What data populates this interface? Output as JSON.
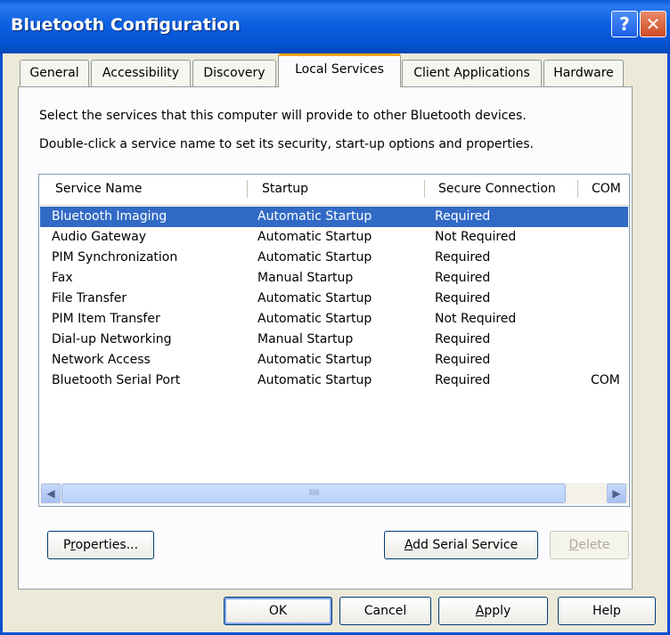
{
  "window": {
    "title": "Bluetooth Configuration",
    "help_glyph": "?",
    "close_glyph": "✕"
  },
  "tabs": [
    {
      "label": "General",
      "active": false
    },
    {
      "label": "Accessibility",
      "active": false
    },
    {
      "label": "Discovery",
      "active": false
    },
    {
      "label": "Local Services",
      "active": true
    },
    {
      "label": "Client Applications",
      "active": false
    },
    {
      "label": "Hardware",
      "active": false
    }
  ],
  "instructions": {
    "line1": "Select the services that this computer will provide to other Bluetooth devices.",
    "line2": "Double-click a service name to set its security, start-up options and properties."
  },
  "list": {
    "columns": [
      "Service Name",
      "Startup",
      "Secure Connection",
      "COM"
    ],
    "rows": [
      {
        "name": "Bluetooth Imaging",
        "startup": "Automatic Startup",
        "secure": "Required",
        "com": "",
        "selected": true
      },
      {
        "name": "Audio Gateway",
        "startup": "Automatic Startup",
        "secure": "Not Required",
        "com": ""
      },
      {
        "name": "PIM Synchronization",
        "startup": "Automatic Startup",
        "secure": "Required",
        "com": ""
      },
      {
        "name": "Fax",
        "startup": "Manual Startup",
        "secure": "Required",
        "com": ""
      },
      {
        "name": "File Transfer",
        "startup": "Automatic Startup",
        "secure": "Required",
        "com": ""
      },
      {
        "name": "PIM Item Transfer",
        "startup": "Automatic Startup",
        "secure": "Not Required",
        "com": ""
      },
      {
        "name": "Dial-up Networking",
        "startup": "Manual Startup",
        "secure": "Required",
        "com": ""
      },
      {
        "name": "Network Access",
        "startup": "Automatic Startup",
        "secure": "Required",
        "com": ""
      },
      {
        "name": "Bluetooth Serial Port",
        "startup": "Automatic Startup",
        "secure": "Required",
        "com": "COM"
      }
    ],
    "scroll_left_glyph": "◀",
    "scroll_right_glyph": "▶",
    "thumb_grip": "IIIIIII"
  },
  "panel_buttons": {
    "properties": {
      "pre": "P",
      "accel": "r",
      "post": "operties..."
    },
    "add_serial": {
      "pre": "",
      "accel": "A",
      "post": "dd Serial Service"
    },
    "delete": {
      "pre": "",
      "accel": "D",
      "post": "elete"
    }
  },
  "dialog_buttons": {
    "ok": "OK",
    "cancel": "Cancel",
    "apply": {
      "pre": "",
      "accel": "A",
      "post": "pply"
    },
    "help": "Help"
  },
  "colors": {
    "title_bar": "#0a5ad8",
    "selection": "#316ac5",
    "active_tab_accent": "#f4a51a",
    "dialog_background": "#ece9d8"
  },
  "icons": [
    "help-icon",
    "close-icon",
    "scroll-left-icon",
    "scroll-right-icon"
  ]
}
